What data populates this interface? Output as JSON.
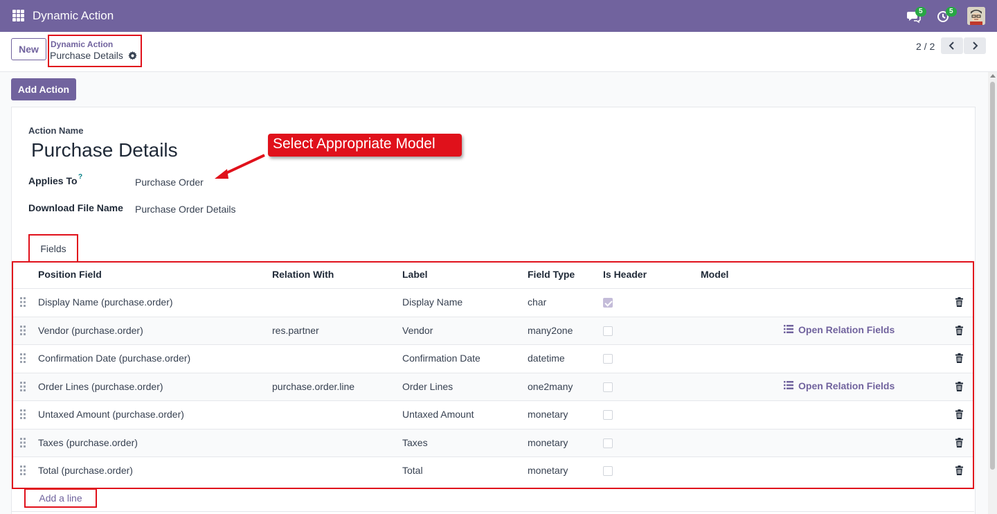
{
  "navbar": {
    "app_title": "Dynamic Action",
    "messages_count": "5",
    "activities_count": "5"
  },
  "control_panel": {
    "new_label": "New",
    "breadcrumb_parent": "Dynamic Action",
    "breadcrumb_current": "Purchase Details",
    "pager": "2 / 2"
  },
  "toolbar": {
    "add_action_label": "Add Action"
  },
  "form": {
    "action_name_label": "Action Name",
    "action_name_value": "Purchase Details",
    "applies_to_label": "Applies To",
    "applies_to_help": "?",
    "applies_to_value": "Purchase Order",
    "download_label": "Download File Name",
    "download_value": "Purchase Order Details"
  },
  "callout": {
    "text": "Select Appropriate Model"
  },
  "tabs": [
    {
      "label": "Fields"
    }
  ],
  "table": {
    "headers": [
      "Position Field",
      "Relation With",
      "Label",
      "Field Type",
      "Is Header",
      "Model"
    ],
    "open_relation_label": "Open Relation Fields",
    "rows": [
      {
        "position_field": "Display Name (purchase.order)",
        "relation_with": "",
        "label": "Display Name",
        "field_type": "char",
        "is_header": true,
        "open_relation": false
      },
      {
        "position_field": "Vendor (purchase.order)",
        "relation_with": "res.partner",
        "label": "Vendor",
        "field_type": "many2one",
        "is_header": false,
        "open_relation": true
      },
      {
        "position_field": "Confirmation Date (purchase.order)",
        "relation_with": "",
        "label": "Confirmation Date",
        "field_type": "datetime",
        "is_header": false,
        "open_relation": false
      },
      {
        "position_field": "Order Lines (purchase.order)",
        "relation_with": "purchase.order.line",
        "label": "Order Lines",
        "field_type": "one2many",
        "is_header": false,
        "open_relation": true
      },
      {
        "position_field": "Untaxed Amount (purchase.order)",
        "relation_with": "",
        "label": "Untaxed Amount",
        "field_type": "monetary",
        "is_header": false,
        "open_relation": false
      },
      {
        "position_field": "Taxes (purchase.order)",
        "relation_with": "",
        "label": "Taxes",
        "field_type": "monetary",
        "is_header": false,
        "open_relation": false
      },
      {
        "position_field": "Total (purchase.order)",
        "relation_with": "",
        "label": "Total",
        "field_type": "monetary",
        "is_header": false,
        "open_relation": false
      }
    ],
    "add_line_label": "Add a line"
  },
  "colors": {
    "brand": "#71639e",
    "highlight": "#e0111b",
    "badge": "#28a745"
  }
}
